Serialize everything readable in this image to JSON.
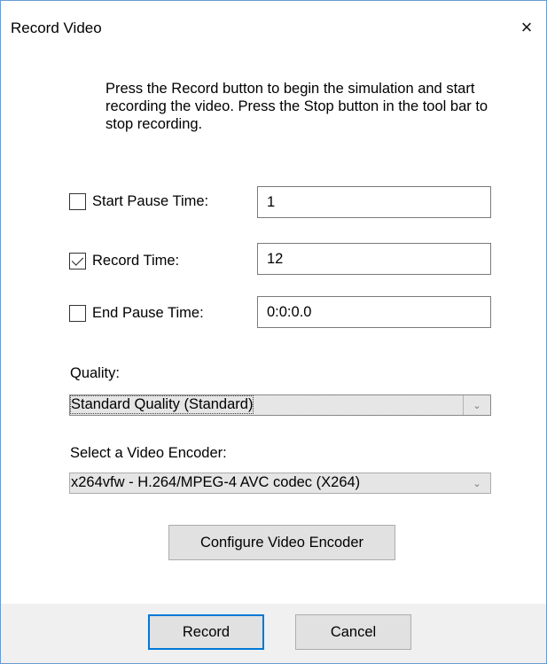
{
  "window": {
    "title": "Record Video",
    "close_icon": "×"
  },
  "instructions": "Press the Record button to begin the simulation and start recording the video. Press the Stop button in the tool bar to stop recording.",
  "fields": [
    {
      "label": "Start Pause Time:",
      "checked": false,
      "value": "1"
    },
    {
      "label": "Record Time:",
      "checked": true,
      "value": "12"
    },
    {
      "label": "End Pause Time:",
      "checked": false,
      "value": "0:0:0.0"
    }
  ],
  "quality": {
    "label": "Quality:",
    "selected": "Standard Quality (Standard)"
  },
  "encoder": {
    "label": "Select a Video Encoder:",
    "selected": "x264vfw - H.264/MPEG-4 AVC codec (X264)"
  },
  "buttons": {
    "configure": "Configure Video Encoder",
    "record": "Record",
    "cancel": "Cancel"
  },
  "dropdown_icon": "chevron-down",
  "colors": {
    "accent": "#0078d7",
    "window_border": "#6a9bd1",
    "footer_bg": "#f0f0f0"
  }
}
